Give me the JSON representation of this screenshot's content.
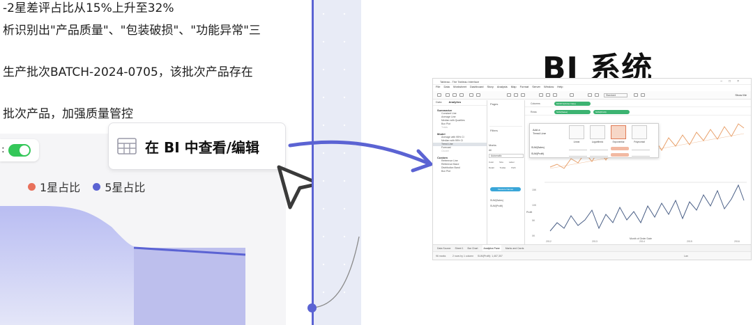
{
  "report": {
    "lines": [
      "-2星差评占比从15%上升至32%",
      "析识别出\"产品质量\"、\"包装破损\"、\"功能异常\"三",
      "生产批次BATCH-2024-0705，该批次产品存在",
      "批次产品，加强质量管控"
    ]
  },
  "legend": {
    "items": [
      {
        "label": "1星占比",
        "color": "#e8705b"
      },
      {
        "label": "5星占比",
        "color": "#5b63d3"
      }
    ]
  },
  "bi_button": {
    "label": "在 BI 中查看/编辑",
    "icon": "table-icon"
  },
  "bi_system": {
    "title": "BI 系统"
  },
  "tableau": {
    "window_title": "Tableau - The Tableau Interface",
    "menu": [
      "File",
      "Data",
      "Worksheet",
      "Dashboard",
      "Story",
      "Analysis",
      "Map",
      "Format",
      "Server",
      "Window",
      "Help"
    ],
    "toolbar_select": "Standard",
    "show_me": "Show Me",
    "side_tabs": [
      "Data",
      "Analytics"
    ],
    "sections": [
      {
        "title": "Summarize",
        "items": [
          "Constant Line",
          "Average Line",
          "Median with Quartiles",
          "Box Plot",
          "Totals"
        ],
        "disabled": [
          "Totals"
        ]
      },
      {
        "title": "Model",
        "items": [
          "Average with 95% CI",
          "Median with 95% CI",
          "Trend Line",
          "Forecast",
          "Cluster"
        ],
        "selected": "Trend Line",
        "disabled": [
          "Cluster"
        ]
      },
      {
        "title": "Custom",
        "items": [
          "Reference Line",
          "Reference Band",
          "Distribution Band",
          "Box Plot"
        ]
      }
    ],
    "cards": {
      "pages": "Pages",
      "filters": "Filters",
      "marks": "Marks",
      "all": "All",
      "automatic": "Automatic",
      "mark_buttons": [
        "Color",
        "Size",
        "Label",
        "Detail",
        "Tooltip",
        "Path"
      ],
      "measure_names": "Measure Names",
      "rows": [
        "SUM(Sales)",
        "SUM(Profit)"
      ]
    },
    "shelves": {
      "columns_label": "Columns",
      "rows_label": "Rows",
      "columns_pill": "MONTH(Order Date)",
      "rows_pills": [
        "SUM(Sales)",
        "SUM(Profit)"
      ]
    },
    "trend_popup": {
      "title": "Add a Trend Line",
      "options": [
        "Linear",
        "Logarithmic",
        "Exponential",
        "Polynomial"
      ],
      "selected": "Exponential",
      "rows": [
        "SUM(Sales)",
        "SUM(Profit)"
      ]
    },
    "x_axis": {
      "label": "Month of Order Date",
      "ticks": [
        "2012",
        "2013",
        "2014",
        "2015",
        "2016"
      ]
    },
    "y_axis_bottom": {
      "label": "Profit",
      "ticks": [
        "15K",
        "10K",
        "5K",
        "0K"
      ]
    },
    "bottom_tabs": [
      "Data Source",
      "Sheet 1",
      "Bar Chart",
      "Analytics Pane",
      "Marks and Cards"
    ],
    "active_tab": "Analytics Pane",
    "status": {
      "marks": "96 marks",
      "rows_cols": "2 rows by 1 column",
      "sum": "SUM(Profit): 1,467,307",
      "user": "Lan"
    }
  },
  "colors": {
    "accent": "#5b63d3",
    "toggle": "#34c759",
    "strip": "#e8ebf6",
    "sales_line": "#e8a06a",
    "profit_line": "#4a5f86"
  },
  "icons": [
    "table-icon",
    "cursor-icon",
    "arrow-icon",
    "toggle-icon"
  ]
}
